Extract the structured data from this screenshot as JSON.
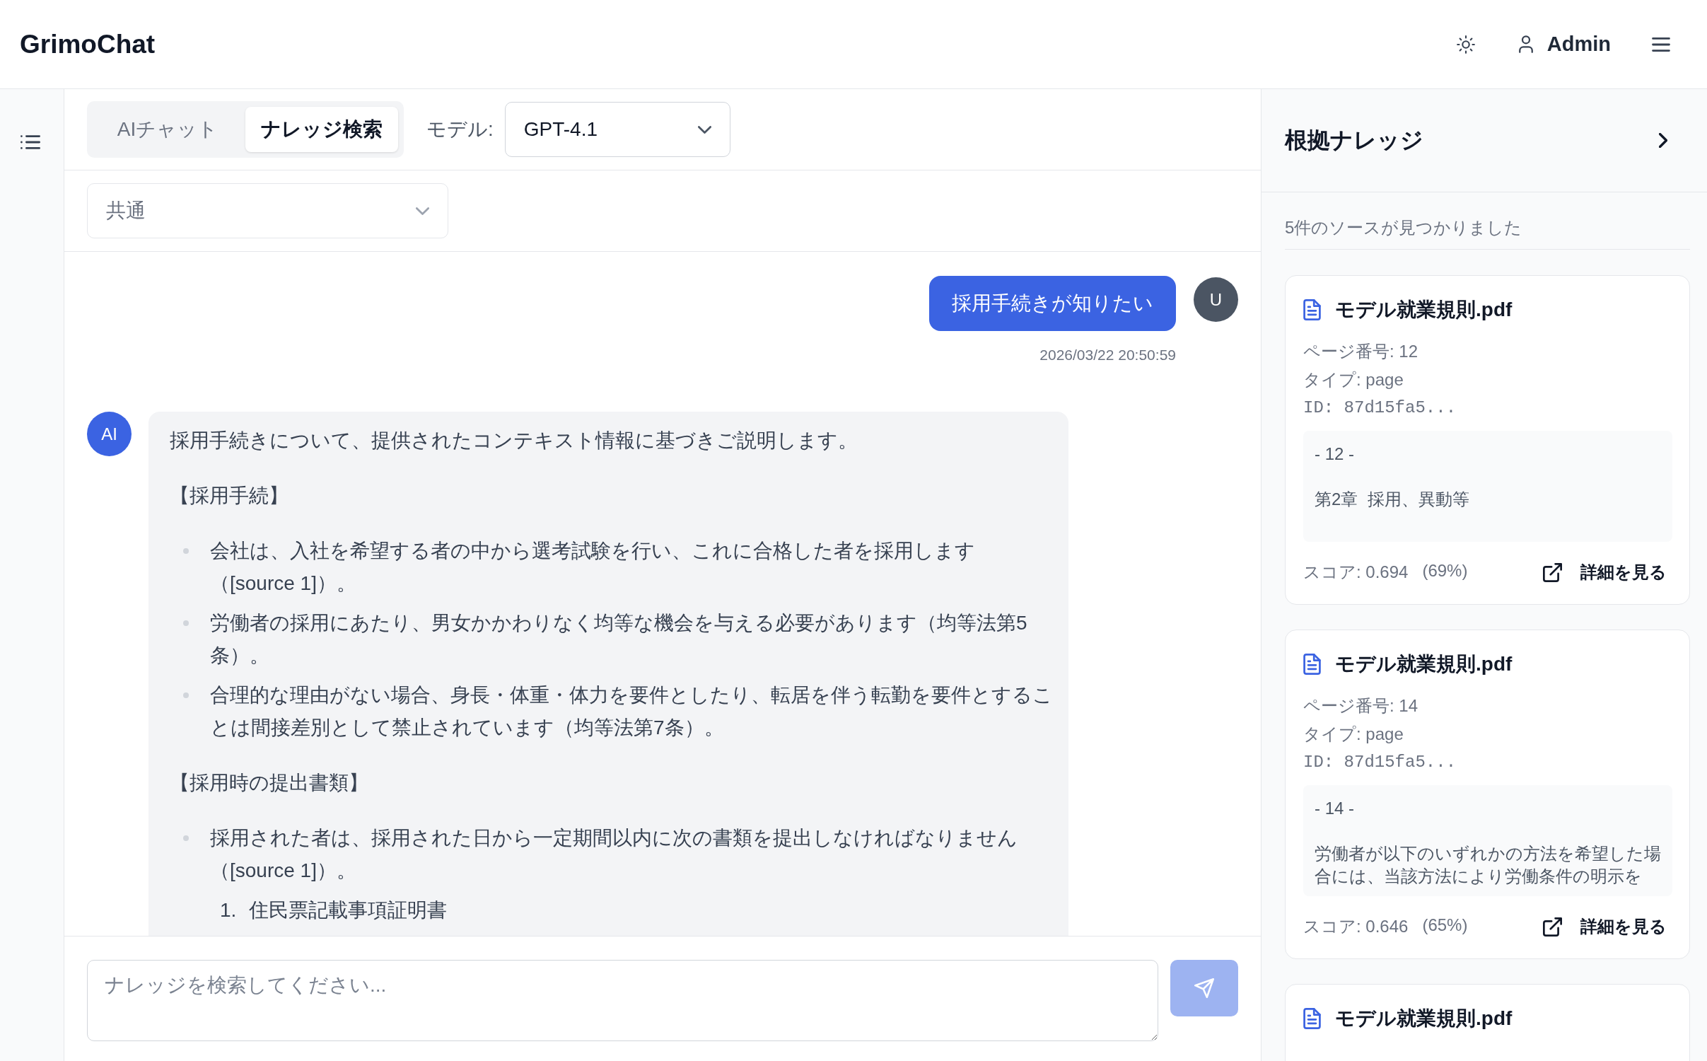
{
  "header": {
    "logo": "GrimoChat",
    "user_name": "Admin"
  },
  "toolbar": {
    "tabs": [
      {
        "label": "AIチャット",
        "selected": false
      },
      {
        "label": "ナレッジ検索",
        "selected": true
      }
    ],
    "model_label": "モデル:",
    "model_select": "GPT-4.1"
  },
  "category_select": "共通",
  "messages": [
    {
      "kind": "user",
      "avatar": "U",
      "text": "採用手続きが知りたい",
      "time": "2026/03/22 20:50:59"
    },
    {
      "kind": "assistant",
      "avatar": "AI",
      "blocks": [
        {
          "kind": "paragraph",
          "text": "採用手続きについて、提供されたコンテキスト情報に基づきご説明します。"
        },
        {
          "kind": "paragraph",
          "text": "【採用手続】"
        },
        {
          "kind": "bullets",
          "items": [
            {
              "text": "会社は、入社を希望する者の中から選考試験を行い、これに合格した者を採用します（[source 1]）。"
            },
            {
              "text": "労働者の採用にあたり、男女かかわりなく均等な機会を与える必要があります（均等法第5条）。"
            },
            {
              "text": "合理的な理由がない場合、身長・体重・体力を要件としたり、転居を伴う転勤を要件とすることは間接差別として禁止されています（均等法第7条）。"
            }
          ]
        },
        {
          "kind": "paragraph",
          "text": "【採用時の提出書類】"
        },
        {
          "kind": "bullets",
          "items": [
            {
              "text": "採用された者は、採用された日から一定期間以内に次の書類を提出しなければなりません（[source 1]）。",
              "children": [
                {
                  "number": "1.",
                  "text": "住民票記載事項証明書"
                }
              ]
            }
          ]
        }
      ]
    }
  ],
  "composer": {
    "placeholder": "ナレッジを検索してください...",
    "send_button": {
      "disabled": true
    }
  },
  "sources_panel": {
    "title": "根拠ナレッジ",
    "summary": "5件のソースが見つかりました",
    "cards": [
      {
        "file_name": "モデル就業規則.pdf",
        "page": "ページ番号: 12",
        "type": "タイプ: page",
        "id": "ID: 87d15fa5...",
        "excerpt": [
          "- 12 -",
          "第2章  採用、異動等"
        ],
        "score": "スコア: 0.694",
        "percent": "(69%)",
        "link": "詳細を見る"
      },
      {
        "file_name": "モデル就業規則.pdf",
        "page": "ページ番号: 14",
        "type": "タイプ: page",
        "id": "ID: 87d15fa5...",
        "excerpt": [
          "- 14 -",
          "労働者が以下のいずれかの方法を希望した場合には、当該方法により労働条件の明示を"
        ],
        "score": "スコア: 0.646",
        "percent": "(65%)",
        "link": "詳細を見る"
      },
      {
        "file_name": "モデル就業規則.pdf"
      }
    ]
  }
}
